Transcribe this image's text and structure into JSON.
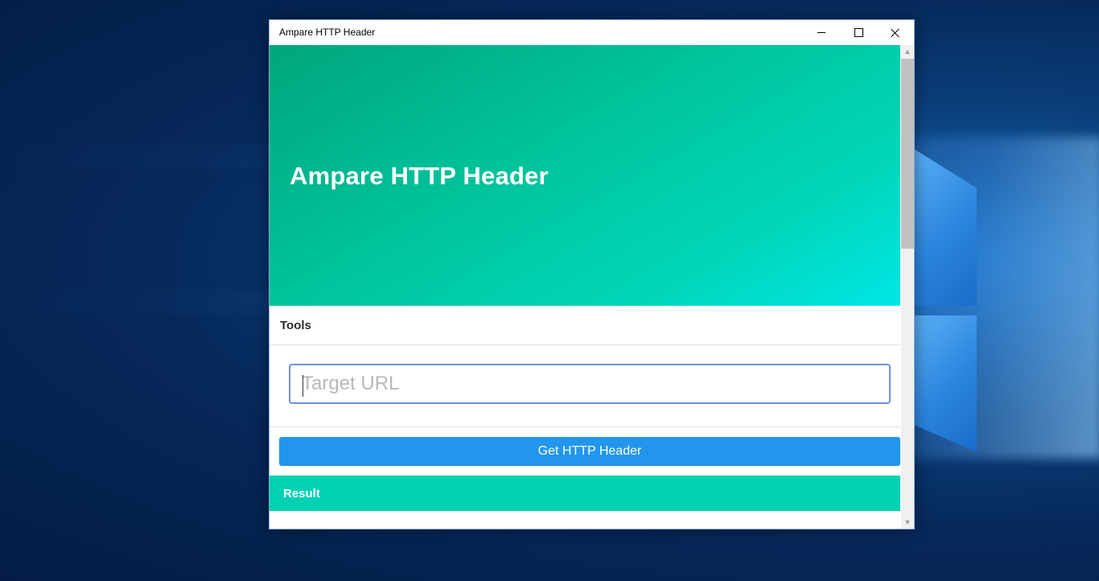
{
  "window": {
    "title": "Ampare HTTP Header",
    "controls": {
      "minimize_icon": "minimize-icon",
      "maximize_icon": "maximize-icon",
      "close_icon": "close-icon"
    }
  },
  "hero": {
    "title": "Ampare HTTP Header",
    "gradient_start": "#00a67c",
    "gradient_end": "#00e6e6"
  },
  "tools": {
    "heading": "Tools",
    "url_input": {
      "placeholder": "Target URL",
      "value": ""
    },
    "submit_label": "Get HTTP Header",
    "submit_color": "#2196ec"
  },
  "result": {
    "heading": "Result",
    "color": "#00d1b2"
  },
  "scrollbar": {
    "up_icon": "scroll-up-arrow-icon",
    "down_icon": "scroll-down-arrow-icon"
  }
}
